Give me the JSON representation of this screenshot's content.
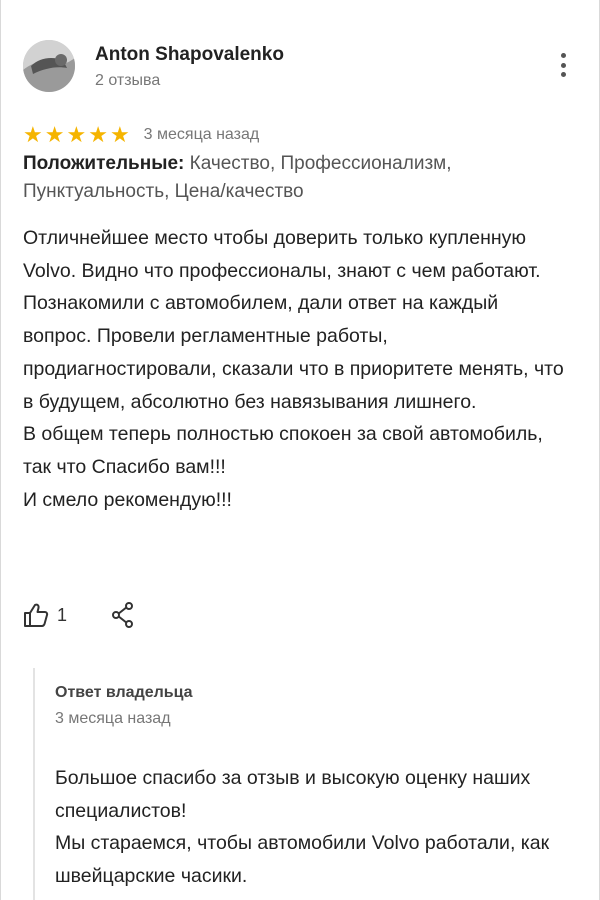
{
  "review": {
    "author": {
      "name": "Anton Shapovalenko",
      "meta": "2 отзыва"
    },
    "rating": 5,
    "stars": [
      "★",
      "★",
      "★",
      "★",
      "★"
    ],
    "date": "3 месяца назад",
    "positives_label": "Положительные:",
    "positives_text": " Качество, Профессионализм, Пунктуальность, Цена/качество",
    "text": "Отличнейшее место чтобы доверить только купленную Volvo. Видно что профессионалы, знают с чем работают. Познакомили с автомобилем, дали ответ на каждый вопрос. Провели регламентные работы, продиагностировали, сказали что в приоритете менять, что в будущем, абсолютно без навязывания лишнего.\nВ общем теперь полностью спокоен за свой автомобиль, так что Спасибо вам!!!\nИ смело рекомендую!!!",
    "likes": "1"
  },
  "owner_reply": {
    "title": "Ответ владельца",
    "date": "3 месяца назад",
    "text": "Большое спасибо за отзыв и высокую оценку наших специалистов!\nМы стараемся, чтобы автомобили Volvo работали, как швейцарские часики."
  },
  "icons": {
    "more": "more-vertical-icon",
    "like": "thumbs-up-icon",
    "share": "share-icon",
    "star": "star-icon"
  },
  "colors": {
    "star": "#f5b400",
    "muted_text": "#777777",
    "text": "#222222"
  }
}
